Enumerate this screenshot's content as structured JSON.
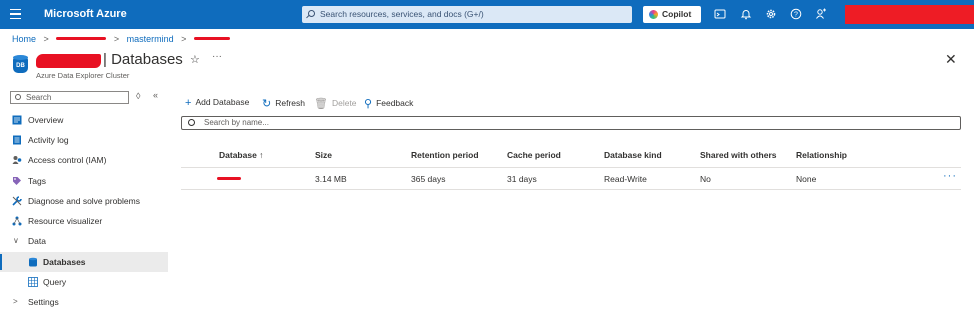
{
  "topbar": {
    "brand": "Microsoft Azure",
    "search_placeholder": "Search resources, services, and docs (G+/)",
    "copilot_label": "Copilot",
    "icons": [
      "terminal-icon",
      "bell-icon",
      "gear-icon",
      "help-icon",
      "feedback-icon"
    ]
  },
  "breadcrumb": {
    "home": "Home",
    "middle": "mastermind"
  },
  "header": {
    "title": "Databases",
    "separator": "|",
    "subtitle": "Azure Data Explorer Cluster",
    "badge": "DB"
  },
  "sidebar": {
    "search_placeholder": "Search",
    "items": [
      {
        "label": "Overview",
        "icon": "overview-icon"
      },
      {
        "label": "Activity log",
        "icon": "activity-log-icon"
      },
      {
        "label": "Access control (IAM)",
        "icon": "iam-icon"
      },
      {
        "label": "Tags",
        "icon": "tag-icon"
      },
      {
        "label": "Diagnose and solve problems",
        "icon": "wrench-icon"
      },
      {
        "label": "Resource visualizer",
        "icon": "visualizer-icon"
      },
      {
        "label": "Data",
        "icon": "chevron-down-icon"
      },
      {
        "label": "Databases",
        "icon": "database-icon"
      },
      {
        "label": "Query",
        "icon": "query-icon"
      },
      {
        "label": "Settings",
        "icon": "chevron-right-icon"
      }
    ]
  },
  "toolbar": {
    "add": "Add Database",
    "refresh": "Refresh",
    "delete": "Delete",
    "feedback": "Feedback"
  },
  "filter": {
    "placeholder": "Search by name..."
  },
  "table": {
    "headers": [
      "Database ↑",
      "Size",
      "Retention period",
      "Cache period",
      "Database kind",
      "Shared with others",
      "Relationship"
    ],
    "rows": [
      {
        "size": "3.14 MB",
        "retention": "365 days",
        "cache": "31 days",
        "kind": "Read-Write",
        "shared": "No",
        "relationship": "None"
      }
    ]
  },
  "colors": {
    "topbar": "#0f6cbd",
    "accent": "#0f6cbd",
    "redaction": "#e81123"
  }
}
